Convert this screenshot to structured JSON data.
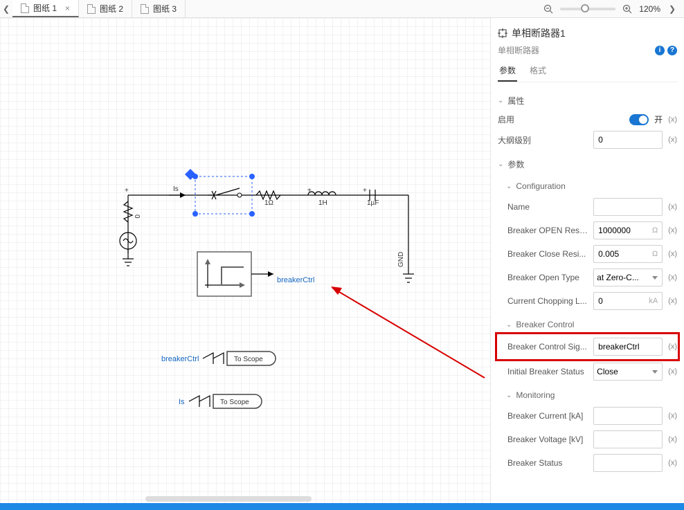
{
  "topbar": {
    "tabs": [
      {
        "label": "图纸 1",
        "active": true
      },
      {
        "label": "图纸 2",
        "active": false
      },
      {
        "label": "图纸 3",
        "active": false
      }
    ],
    "zoom_percent": "120%"
  },
  "canvas": {
    "is_label": "Is",
    "source_value": "0",
    "resistor_value": "1Ω",
    "inductor_value": "1H",
    "capacitor_value": "1µF",
    "ground_label": "GND",
    "breaker_ctrl_signal": "breakerCtrl",
    "scope1": {
      "signal": "breakerCtrl",
      "text": "To Scope"
    },
    "scope2": {
      "signal": "Is",
      "text": "To Scope"
    }
  },
  "panel": {
    "title": "单相断路器1",
    "subtype": "单相断路器",
    "tabs": {
      "params": "参数",
      "format": "格式"
    },
    "attr_section": "属性",
    "enable_label": "启用",
    "enable_state": "开",
    "outline_label": "大纲级别",
    "outline_value": "0",
    "params_section": "参数",
    "config_section": "Configuration",
    "name_label": "Name",
    "name_value": "",
    "open_res_label": "Breaker OPEN Resi...",
    "open_res_value": "1000000",
    "open_res_unit": "Ω",
    "close_res_label": "Breaker Close Resi...",
    "close_res_value": "0.005",
    "close_res_unit": "Ω",
    "open_type_label": "Breaker Open Type",
    "open_type_value": "at Zero-C...",
    "chop_label": "Current Chopping L...",
    "chop_value": "0",
    "chop_unit": "kA",
    "control_section": "Breaker Control",
    "ctrl_sig_label": "Breaker Control Sig...",
    "ctrl_sig_value": "breakerCtrl",
    "init_status_label": "Initial Breaker Status",
    "init_status_value": "Close",
    "monitoring_section": "Monitoring",
    "mon_current_label": "Breaker Current [kA]",
    "mon_current_value": "",
    "mon_voltage_label": "Breaker Voltage [kV]",
    "mon_voltage_value": "",
    "mon_status_label": "Breaker Status",
    "mon_status_value": "",
    "x_btn": "(x)"
  }
}
